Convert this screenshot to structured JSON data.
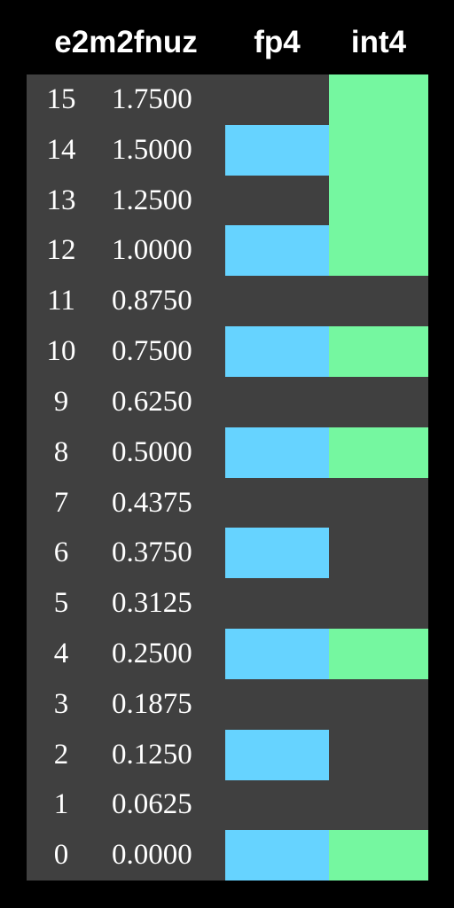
{
  "headers": {
    "main": "e2m2fnuz",
    "fp4": "fp4",
    "int4": "int4"
  },
  "colors": {
    "background": "#000000",
    "table": "#404040",
    "fp4": "#66d3ff",
    "int4": "#75f7a0"
  },
  "rows": [
    {
      "index": "15",
      "value": "1.7500",
      "fp4": false,
      "int4": true
    },
    {
      "index": "14",
      "value": "1.5000",
      "fp4": true,
      "int4": true
    },
    {
      "index": "13",
      "value": "1.2500",
      "fp4": false,
      "int4": true
    },
    {
      "index": "12",
      "value": "1.0000",
      "fp4": true,
      "int4": true
    },
    {
      "index": "11",
      "value": "0.8750",
      "fp4": false,
      "int4": false
    },
    {
      "index": "10",
      "value": "0.7500",
      "fp4": true,
      "int4": true
    },
    {
      "index": "9",
      "value": "0.6250",
      "fp4": false,
      "int4": false
    },
    {
      "index": "8",
      "value": "0.5000",
      "fp4": true,
      "int4": true
    },
    {
      "index": "7",
      "value": "0.4375",
      "fp4": false,
      "int4": false
    },
    {
      "index": "6",
      "value": "0.3750",
      "fp4": true,
      "int4": false
    },
    {
      "index": "5",
      "value": "0.3125",
      "fp4": false,
      "int4": false
    },
    {
      "index": "4",
      "value": "0.2500",
      "fp4": true,
      "int4": true
    },
    {
      "index": "3",
      "value": "0.1875",
      "fp4": false,
      "int4": false
    },
    {
      "index": "2",
      "value": "0.1250",
      "fp4": true,
      "int4": false
    },
    {
      "index": "1",
      "value": "0.0625",
      "fp4": false,
      "int4": false
    },
    {
      "index": "0",
      "value": "0.0000",
      "fp4": true,
      "int4": true
    }
  ]
}
